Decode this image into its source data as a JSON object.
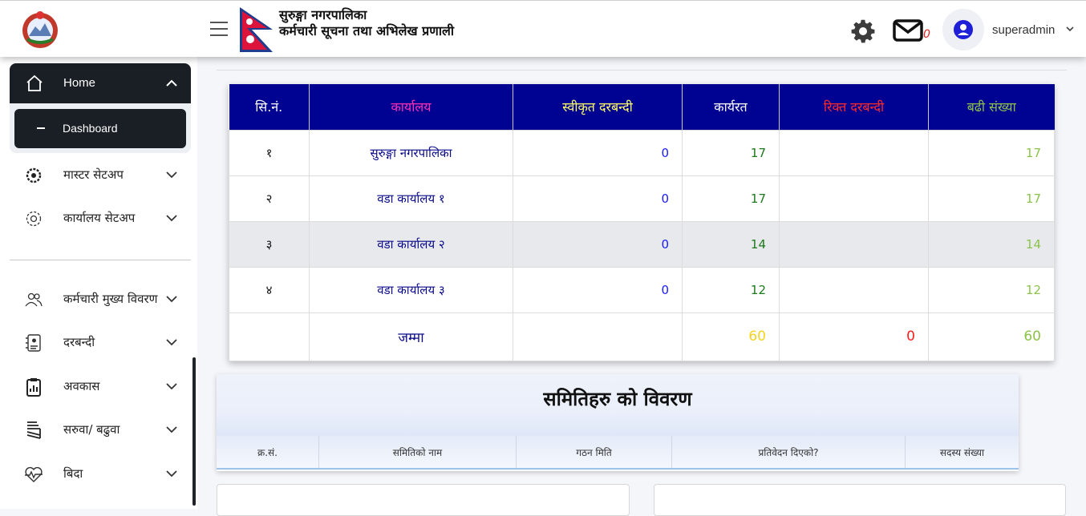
{
  "header": {
    "org_name": "सुरुङ्गा नगरपालिका",
    "system_name": "कर्मचारी सूचना तथा अभिलेख प्रणाली",
    "mail_count": "0",
    "username": "superadmin"
  },
  "sidebar": {
    "home": "Home",
    "dashboard": "Dashboard",
    "items": [
      {
        "label": "मास्टर सेटअप",
        "icon": "gear-badge-icon"
      },
      {
        "label": "कार्यालय सेटअप",
        "icon": "gear-outline-icon"
      },
      {
        "label": "कर्मचारी मुख्य विवरण",
        "icon": "users-icon"
      },
      {
        "label": "दरबन्दी",
        "icon": "id-card-icon"
      },
      {
        "label": "अवकास",
        "icon": "clipboard-chart-icon"
      },
      {
        "label": "सरुवा/ बढुवा",
        "icon": "stack-icon"
      },
      {
        "label": "बिदा",
        "icon": "heartbeat-icon"
      }
    ]
  },
  "staff_table": {
    "headers": {
      "sn": "सि.नं.",
      "office": "कार्यालय",
      "sanctioned": "स्वीकृत दरबन्दी",
      "working": "कार्यरत",
      "vacant": "रिक्त दरबन्दी",
      "excess": "बढी संख्या"
    },
    "rows": [
      {
        "sn": "१",
        "office": "सुरुङ्गा नगरपालिका",
        "sanctioned": "0",
        "working": "17",
        "vacant": "",
        "excess": "17"
      },
      {
        "sn": "२",
        "office": "वडा कार्यालय १",
        "sanctioned": "0",
        "working": "17",
        "vacant": "",
        "excess": "17"
      },
      {
        "sn": "३",
        "office": "वडा कार्यालय २",
        "sanctioned": "0",
        "working": "14",
        "vacant": "",
        "excess": "14"
      },
      {
        "sn": "४",
        "office": "वडा कार्यालय ३",
        "sanctioned": "0",
        "working": "12",
        "vacant": "",
        "excess": "12"
      }
    ],
    "total": {
      "label": "जम्मा",
      "working": "60",
      "vacant": "0",
      "excess": "60"
    }
  },
  "committee": {
    "title": "समितिहरु को विवरण",
    "headers": [
      "क्र.सं.",
      "समितिको नाम",
      "गठन मिति",
      "प्रतिवेदन दिएको?",
      "सदस्य संख्या"
    ]
  },
  "colors": {
    "header_bg": "#000292",
    "office_header": "#ff2fb4",
    "sanctioned_header": "#ffff66",
    "working_header": "#ffffff",
    "vacant_header": "#ff2a2a",
    "excess_header": "#8bc34a",
    "sanctioned_value": "#1a1aff",
    "working_value": "#1b7a1b",
    "total_working": "#f5d31e",
    "total_vacant": "#ff2020",
    "excess_value": "#8bc34a",
    "sidebar_active": "#1a1f25"
  }
}
